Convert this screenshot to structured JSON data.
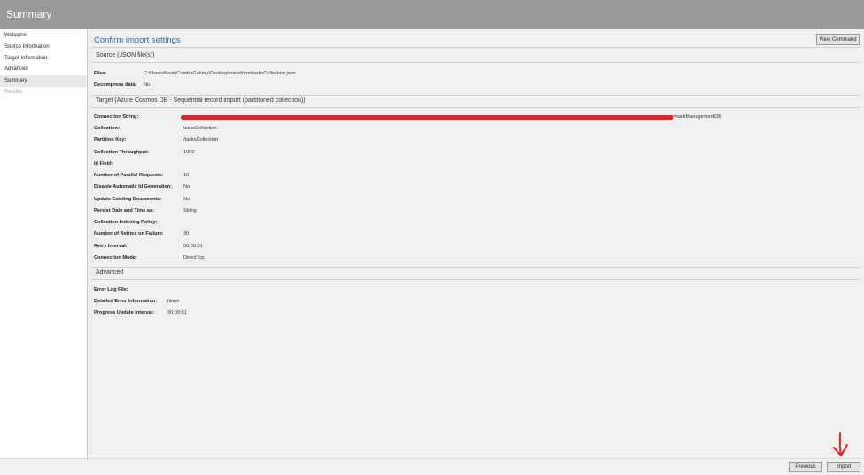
{
  "window": {
    "title": "Summary"
  },
  "sidebar": {
    "items": [
      {
        "label": "Welcome",
        "state": "normal"
      },
      {
        "label": "Source Information",
        "state": "normal"
      },
      {
        "label": "Target Information",
        "state": "normal"
      },
      {
        "label": "Advanced",
        "state": "normal"
      },
      {
        "label": "Summary",
        "state": "active"
      },
      {
        "label": "Results",
        "state": "disabled"
      }
    ]
  },
  "main": {
    "title": "Confirm import settings",
    "view_command_label": "View Command",
    "source": {
      "header": "Source (JSON file(s))",
      "rows": [
        {
          "label": "Files:",
          "value": "C:\\Users\\KevinCombaGatimu\\Desktop\\transform\\tasksCollection.json"
        },
        {
          "label": "Decompress data:",
          "value": "No"
        }
      ]
    },
    "target": {
      "header": "Target (Azure Cosmos DB - Sequential record import (partitioned collection))",
      "connection_string_label": "Connection String:",
      "connection_string_visible_suffix": "=taskManagementDB",
      "rows": [
        {
          "label": "Collection:",
          "value": "tasksCollection"
        },
        {
          "label": "Partition Key:",
          "value": "/tasksCollection"
        },
        {
          "label": "Collection Throughput:",
          "value": "1000"
        },
        {
          "label": "Id Field:",
          "value": ""
        },
        {
          "label": "Number of Parallel Requests:",
          "value": "10"
        },
        {
          "label": "Disable Automatic Id Generation:",
          "value": "No"
        },
        {
          "label": "Update Existing Documents:",
          "value": "No"
        },
        {
          "label": "Persist Date and Time as:",
          "value": "String"
        },
        {
          "label": "Collection Indexing Policy:",
          "value": ""
        },
        {
          "label": "Number of Retries on Failure:",
          "value": "30"
        },
        {
          "label": "Retry Interval:",
          "value": "00:00:01"
        },
        {
          "label": "Connection Mode:",
          "value": "DirectTcp"
        }
      ]
    },
    "advanced": {
      "header": "Advanced",
      "rows": [
        {
          "label": "Error Log File:",
          "value": ""
        },
        {
          "label": "Detailed Error Information:",
          "value": "None"
        },
        {
          "label": "Progress Update Interval:",
          "value": "00:00:01"
        }
      ]
    }
  },
  "footer": {
    "previous_label": "Previous",
    "import_label": "Import"
  },
  "colors": {
    "titlebar": "#999999",
    "accent": "#2a6ab5",
    "annotation": "#e32222"
  }
}
